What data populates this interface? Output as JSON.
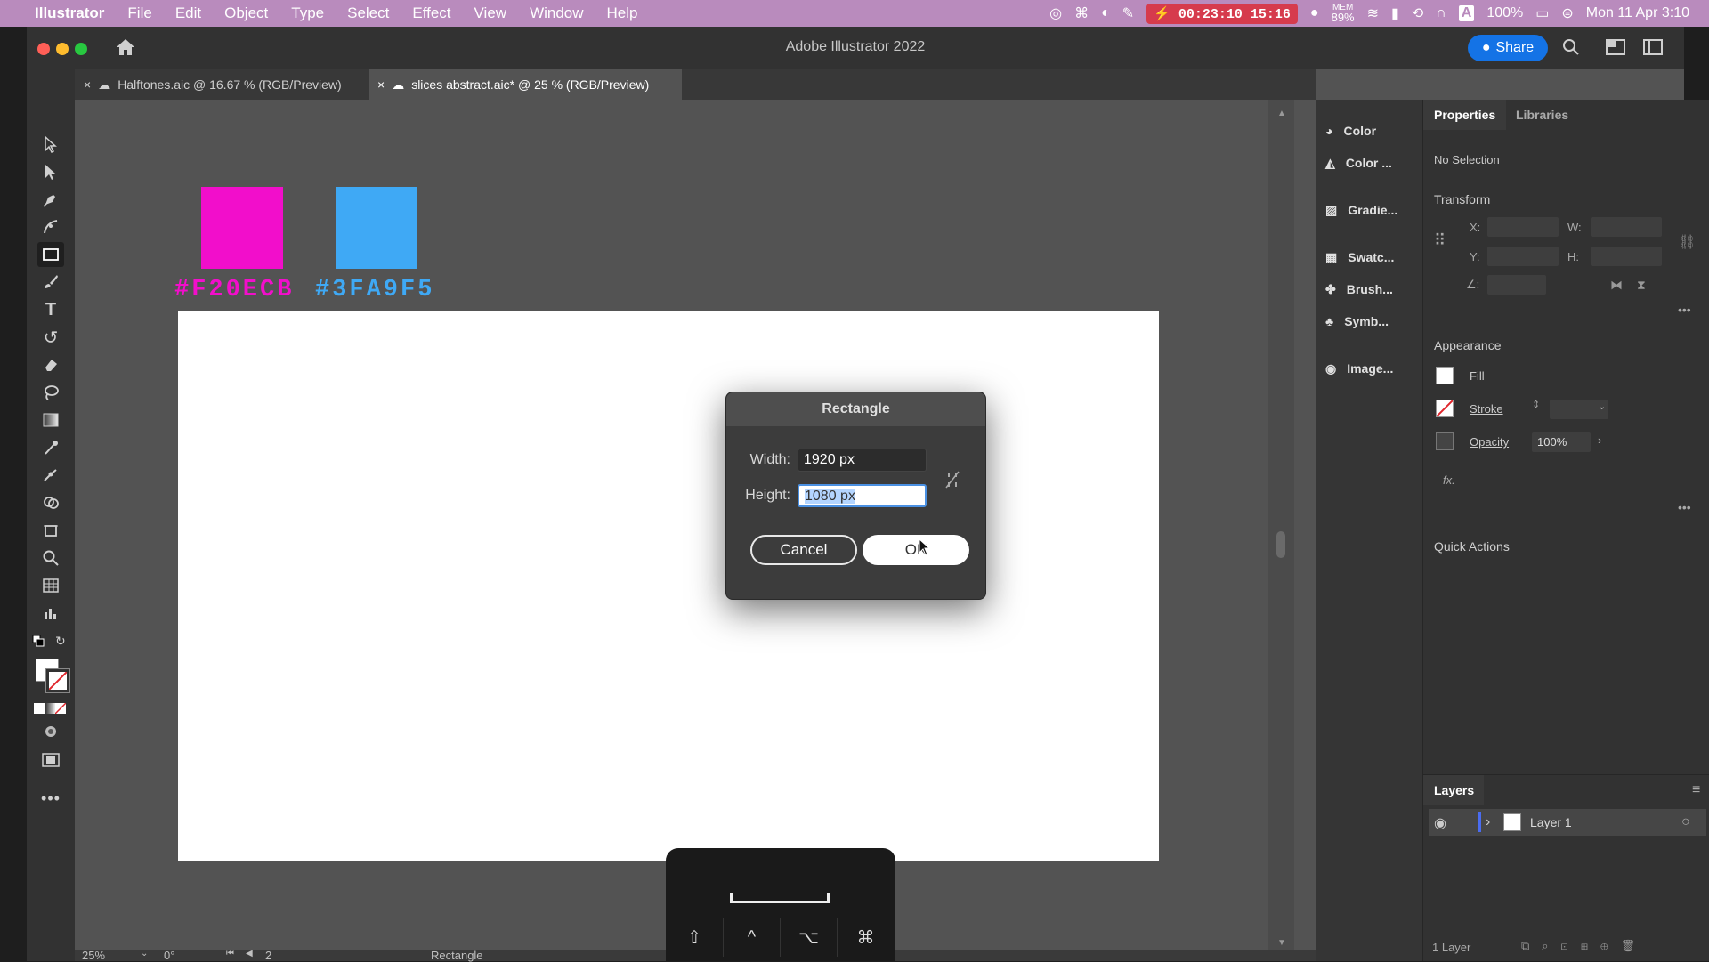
{
  "menubar": {
    "app": "Illustrator",
    "items": [
      "File",
      "Edit",
      "Object",
      "Type",
      "Select",
      "Effect",
      "View",
      "Window",
      "Help"
    ],
    "recording_time": "00:23:10",
    "timer": "15:16",
    "mem_label": "MEM",
    "mem_value": "89%",
    "battery": "100%",
    "datetime": "Mon 11 Apr  3:10"
  },
  "window": {
    "title": "Adobe Illustrator 2022",
    "share_label": "Share"
  },
  "tabs": [
    {
      "label": "Halftones.aic @ 16.67 % (RGB/Preview)",
      "active": false
    },
    {
      "label": "slices abstract.aic* @ 25 % (RGB/Preview)",
      "active": true
    }
  ],
  "swatches": [
    {
      "label": "#F20ECB",
      "color": "#F20ECB"
    },
    {
      "label": "#3FA9F5",
      "color": "#3FA9F5"
    }
  ],
  "dialog": {
    "title": "Rectangle",
    "width_label": "Width:",
    "width_value": "1920 px",
    "height_label": "Height:",
    "height_value": "1080 px",
    "cancel_label": "Cancel",
    "ok_label": "OK"
  },
  "mid_panel": {
    "items": [
      "Color",
      "Color ...",
      "Gradie...",
      "Swatc...",
      "Brush...",
      "Symb...",
      "Image..."
    ]
  },
  "properties": {
    "tab_properties": "Properties",
    "tab_libraries": "Libraries",
    "selection": "No Selection",
    "transform_title": "Transform",
    "x_label": "X:",
    "y_label": "Y:",
    "w_label": "W:",
    "h_label": "H:",
    "appearance_title": "Appearance",
    "fill_label": "Fill",
    "stroke_label": "Stroke",
    "opacity_label": "Opacity",
    "opacity_value": "100%",
    "fx_label": "fx.",
    "quick_actions": "Quick Actions"
  },
  "layers": {
    "title": "Layers",
    "layer_name": "Layer 1",
    "count": "1 Layer"
  },
  "status": {
    "zoom": "25%",
    "rotation": "0°",
    "artboard": "2",
    "tool": "Rectangle"
  },
  "keyhud": {
    "keys": [
      "⇧",
      "^",
      "⌥",
      "⌘"
    ]
  }
}
